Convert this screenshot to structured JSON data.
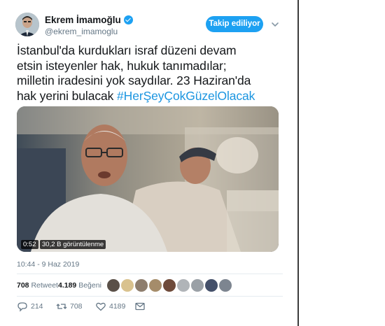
{
  "tweet": {
    "author_name": "Ekrem İmamoğlu",
    "handle": "@ekrem_imamoglu",
    "follow_label": "Takip ediliyor",
    "text_lines": [
      "İstanbul'da kurdukları israf düzeni devam",
      "etsin isteyenler hak, hukuk tanımadılar;",
      "milletin iradesini yok saydılar. 23 Haziran'da",
      "hak yerini bulacak "
    ],
    "hashtag": "#HerŞeyÇokGüzelOlacak",
    "video": {
      "duration": "0:52",
      "views": "30,2 B görüntülenme"
    },
    "timestamp": "10:44 - 9 Haz 2019",
    "stats": {
      "retweets": "708",
      "retweets_label": "Retweet",
      "likes": "4.189",
      "likes_label": "Beğeni"
    },
    "actions": {
      "replies": "214",
      "retweets": "708",
      "likes": "4189"
    }
  },
  "colors": {
    "accent": "#1da1f2",
    "link": "#1b95e0",
    "muted": "#657786",
    "text": "#14171a"
  },
  "icons": [
    "verified-badge-icon",
    "chevron-down-icon",
    "reply-icon",
    "retweet-icon",
    "like-icon",
    "message-icon"
  ]
}
